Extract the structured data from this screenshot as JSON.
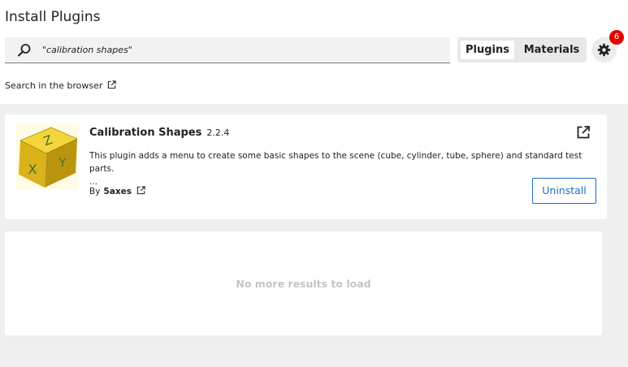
{
  "window": {
    "title": "Install Plugins"
  },
  "search": {
    "value": "\"calibration shapes\""
  },
  "tabs": [
    {
      "label": "Plugins",
      "selected": true
    },
    {
      "label": "Materials",
      "selected": false
    }
  ],
  "settings": {
    "icon": "gear-icon",
    "badge_count": "6",
    "badge_color": "#e00000"
  },
  "browser_link": {
    "label": "Search in the browser",
    "icon": "external-link-icon"
  },
  "plugins": [
    {
      "name": "Calibration Shapes",
      "version": "2.2.4",
      "description": "This plugin adds a menu to create some basic shapes to the scene (cube, cylinder, tube, sphere) and standard test parts.",
      "description_more": "...",
      "author_prefix": "By",
      "author": "5axes",
      "action_label": "Uninstall",
      "thumbnail_letters": [
        "Z",
        "X",
        "Y"
      ]
    }
  ],
  "footer": {
    "message": "No more results to load"
  },
  "colors": {
    "accent": "#196ec8",
    "thumbnail": "#e6c21f"
  }
}
